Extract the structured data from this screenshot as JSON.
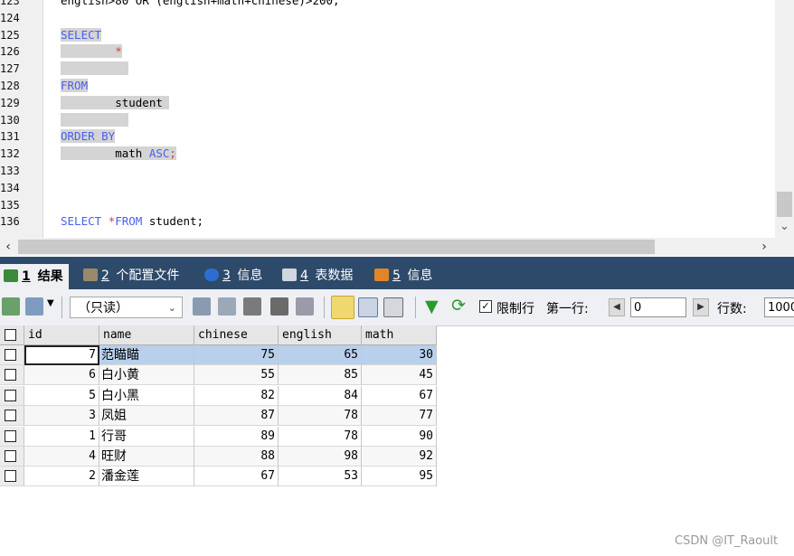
{
  "editor": {
    "lines": [
      {
        "n": "123",
        "parts": [
          {
            "t": "english>80 OR (english+math+chinese)>200;",
            "c": "txt"
          }
        ]
      },
      {
        "n": "124",
        "parts": []
      },
      {
        "n": "125",
        "parts": [
          {
            "t": "SELECT",
            "c": "kw",
            "sel": true
          }
        ]
      },
      {
        "n": "126",
        "parts": [
          {
            "t": "        *",
            "c": "op",
            "sel": true
          }
        ]
      },
      {
        "n": "127",
        "parts": [
          {
            "t": "          ",
            "c": "txt",
            "sel": true
          }
        ]
      },
      {
        "n": "128",
        "parts": [
          {
            "t": "FROM",
            "c": "kw",
            "sel": true
          }
        ]
      },
      {
        "n": "129",
        "parts": [
          {
            "t": "        student ",
            "c": "txt",
            "sel": true
          }
        ]
      },
      {
        "n": "130",
        "parts": [
          {
            "t": "          ",
            "c": "txt",
            "sel": true
          }
        ]
      },
      {
        "n": "131",
        "parts": [
          {
            "t": "ORDER BY",
            "c": "kw",
            "sel": true
          }
        ]
      },
      {
        "n": "132",
        "parts": [
          {
            "t": "        math ",
            "c": "txt",
            "sel": true
          },
          {
            "t": "ASC",
            "c": "kw",
            "sel": true
          },
          {
            "t": ";",
            "c": "op",
            "sel": true
          }
        ]
      },
      {
        "n": "133",
        "parts": []
      },
      {
        "n": "134",
        "parts": []
      },
      {
        "n": "135",
        "parts": []
      },
      {
        "n": "136",
        "parts": [
          {
            "t": "SELECT ",
            "c": "kw"
          },
          {
            "t": "*",
            "c": "op"
          },
          {
            "t": "FROM ",
            "c": "kw"
          },
          {
            "t": "student;",
            "c": "txt"
          }
        ]
      }
    ]
  },
  "tabs": [
    {
      "num": "1",
      "label": "结果",
      "icon": "grid-icon",
      "active": true
    },
    {
      "num": "2",
      "label": "个配置文件",
      "icon": "profile-icon"
    },
    {
      "num": "3",
      "label": "信息",
      "icon": "info-icon"
    },
    {
      "num": "4",
      "label": "表数据",
      "icon": "table-data-icon"
    },
    {
      "num": "5",
      "label": "信息",
      "icon": "history-icon"
    }
  ],
  "toolbar": {
    "mode_value": "（只读）",
    "limit_label": "限制行",
    "limit_checked": true,
    "first_row_label": "第一行:",
    "first_row_value": "0",
    "row_count_label": "行数:",
    "row_count_value": "1000"
  },
  "grid": {
    "columns": [
      "id",
      "name",
      "chinese",
      "english",
      "math"
    ],
    "rows": [
      [
        "7",
        "范瞄瞄",
        "75",
        "65",
        "30"
      ],
      [
        "6",
        "白小黄",
        "55",
        "85",
        "45"
      ],
      [
        "5",
        "白小黑",
        "82",
        "84",
        "67"
      ],
      [
        "3",
        "凤姐",
        "87",
        "78",
        "77"
      ],
      [
        "1",
        "行哥",
        "89",
        "78",
        "90"
      ],
      [
        "4",
        "旺财",
        "88",
        "98",
        "92"
      ],
      [
        "2",
        "潘金莲",
        "67",
        "53",
        "95"
      ]
    ],
    "selected_row": 0
  },
  "watermark": "CSDN @IT_Raoult",
  "colors": {
    "keyword": "#4a5ef0",
    "operator": "#d04040",
    "tab_bar": "#2e4a6a",
    "selection": "#b8d0ec"
  }
}
